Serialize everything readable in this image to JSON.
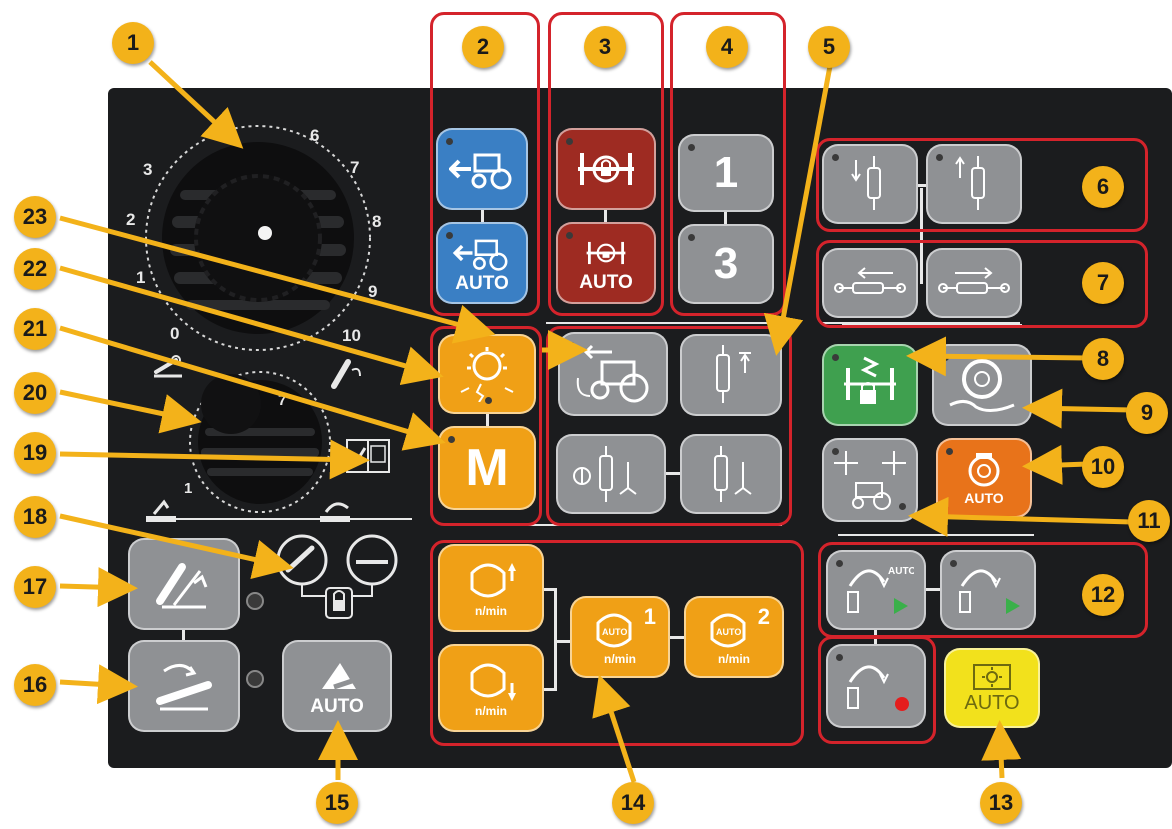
{
  "callouts": [
    "1",
    "2",
    "3",
    "4",
    "5",
    "6",
    "7",
    "8",
    "9",
    "10",
    "11",
    "12",
    "13",
    "14",
    "15",
    "16",
    "17",
    "18",
    "19",
    "20",
    "21",
    "22",
    "23"
  ],
  "knob_scale": {
    "large": [
      "0",
      "1",
      "2",
      "3",
      "6",
      "7",
      "8",
      "9",
      "10"
    ],
    "small": [
      "1",
      "7"
    ]
  },
  "buttons": {
    "auto": "AUTO",
    "one": "1",
    "three": "3",
    "m": "M",
    "nmin": "n/min",
    "idx1": "1",
    "idx2": "2"
  },
  "colors": {
    "panel": "#1b1c1e",
    "callout": "#f3b21a",
    "outline": "#d4232b",
    "gray_button": "#8f9194",
    "blue_button": "#3a7fc4",
    "red_button": "#9e2b22",
    "orange_button": "#f0a016",
    "green_button": "#3fa04f",
    "yellow_button": "#f2e11c"
  }
}
